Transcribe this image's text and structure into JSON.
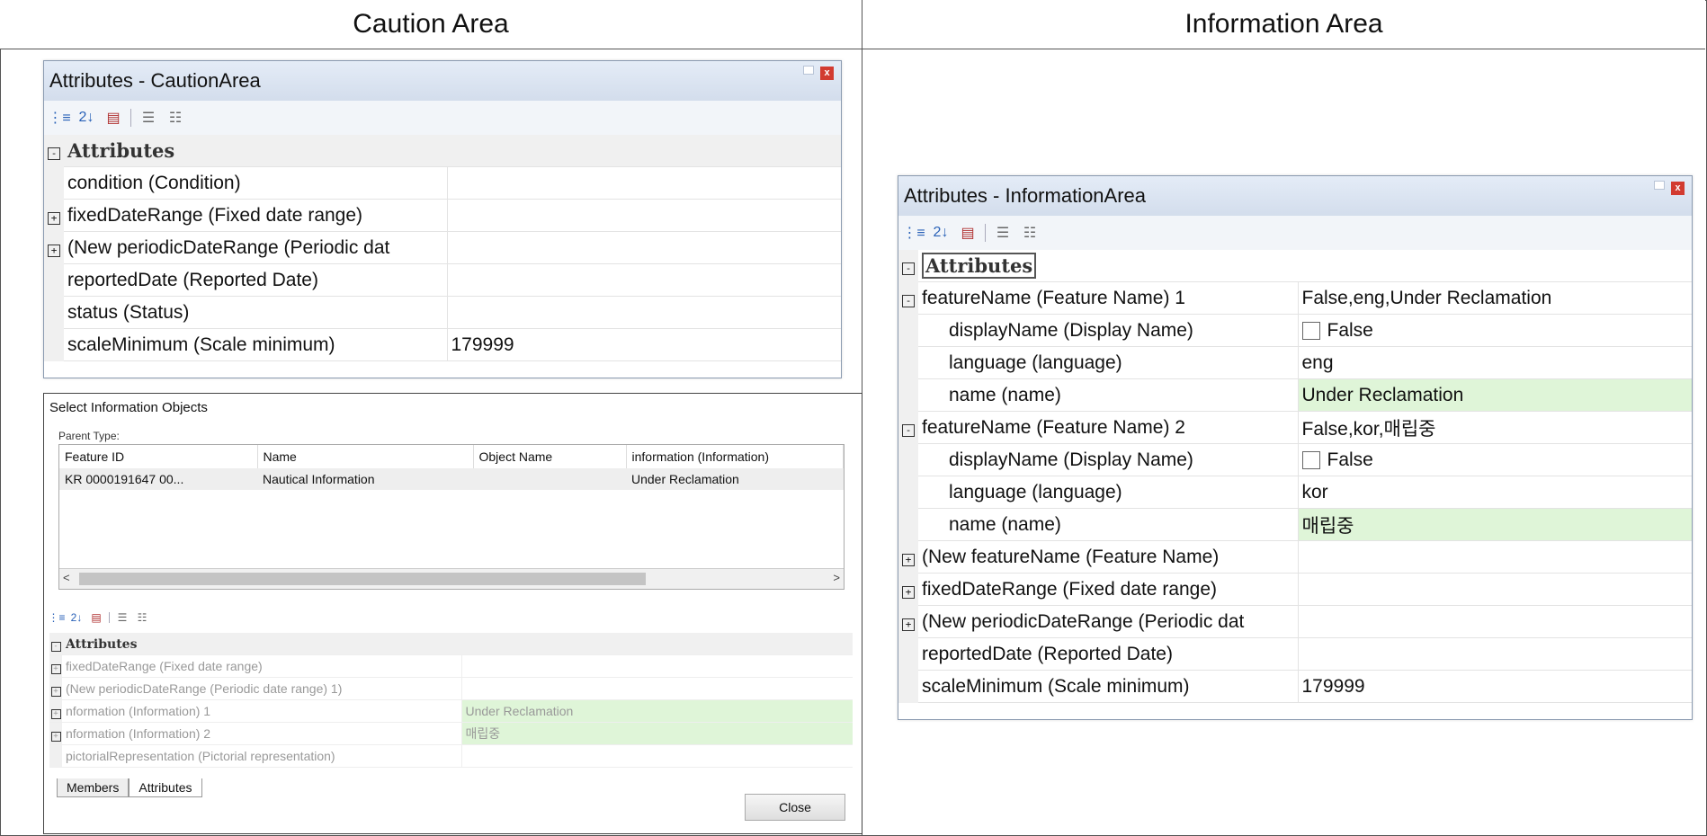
{
  "headers": {
    "left": "Caution Area",
    "right": "Information Area"
  },
  "caution_window": {
    "title": "Attributes - CautionArea",
    "category": "Attributes",
    "rows": [
      {
        "expand": "",
        "name": "condition (Condition)",
        "value": ""
      },
      {
        "expand": "+",
        "name": "fixedDateRange (Fixed date range)",
        "value": ""
      },
      {
        "expand": "+",
        "name": "(New periodicDateRange (Periodic dat",
        "value": ""
      },
      {
        "expand": "",
        "name": "reportedDate (Reported Date)",
        "value": ""
      },
      {
        "expand": "",
        "name": "status (Status)",
        "value": ""
      },
      {
        "expand": "",
        "name": "scaleMinimum (Scale minimum)",
        "value": "179999"
      }
    ]
  },
  "select_dialog": {
    "title": "Select Information Objects",
    "legend": "Parent Type:",
    "columns": [
      "Feature ID",
      "Name",
      "Object Name",
      "information (Information)"
    ],
    "row": [
      "KR 0000191647 00...",
      "Nautical Information",
      "",
      "Under Reclamation"
    ],
    "category": "Attributes",
    "rows": [
      {
        "name": "fixedDateRange (Fixed date range)",
        "value": ""
      },
      {
        "name": "(New periodicDateRange (Periodic date range) 1)",
        "value": ""
      },
      {
        "name": "nformation (Information) 1",
        "value": "Under Reclamation"
      },
      {
        "name": "nformation (Information) 2",
        "value": "매립중"
      },
      {
        "name": "pictorialRepresentation (Pictorial representation)",
        "value": ""
      }
    ],
    "tabs": [
      "Members",
      "Attributes"
    ],
    "close_label": "Close"
  },
  "info_window": {
    "title": "Attributes - InformationArea",
    "category": "Attributes",
    "f1_name": "featureName (Feature Name) 1",
    "f1_value": "False,eng,Under Reclamation",
    "f1_display": "displayName (Display Name)",
    "f1_display_value": "False",
    "f1_lang": "language (language)",
    "f1_lang_value": "eng",
    "f1_nm": "name (name)",
    "f1_nm_value": "Under Reclamation",
    "f2_name": "featureName (Feature Name) 2",
    "f2_value": "False,kor,매립중",
    "f2_display": "displayName (Display Name)",
    "f2_display_value": "False",
    "f2_lang": "language (language)",
    "f2_lang_value": "kor",
    "f2_nm": "name (name)",
    "f2_nm_value": "매립중",
    "new_feature": "(New featureName (Feature Name)",
    "fixed": "fixedDateRange (Fixed date range)",
    "periodic": "(New periodicDateRange (Periodic dat",
    "reported": "reportedDate (Reported Date)",
    "scale": "scaleMinimum (Scale minimum)",
    "scale_value": "179999"
  }
}
